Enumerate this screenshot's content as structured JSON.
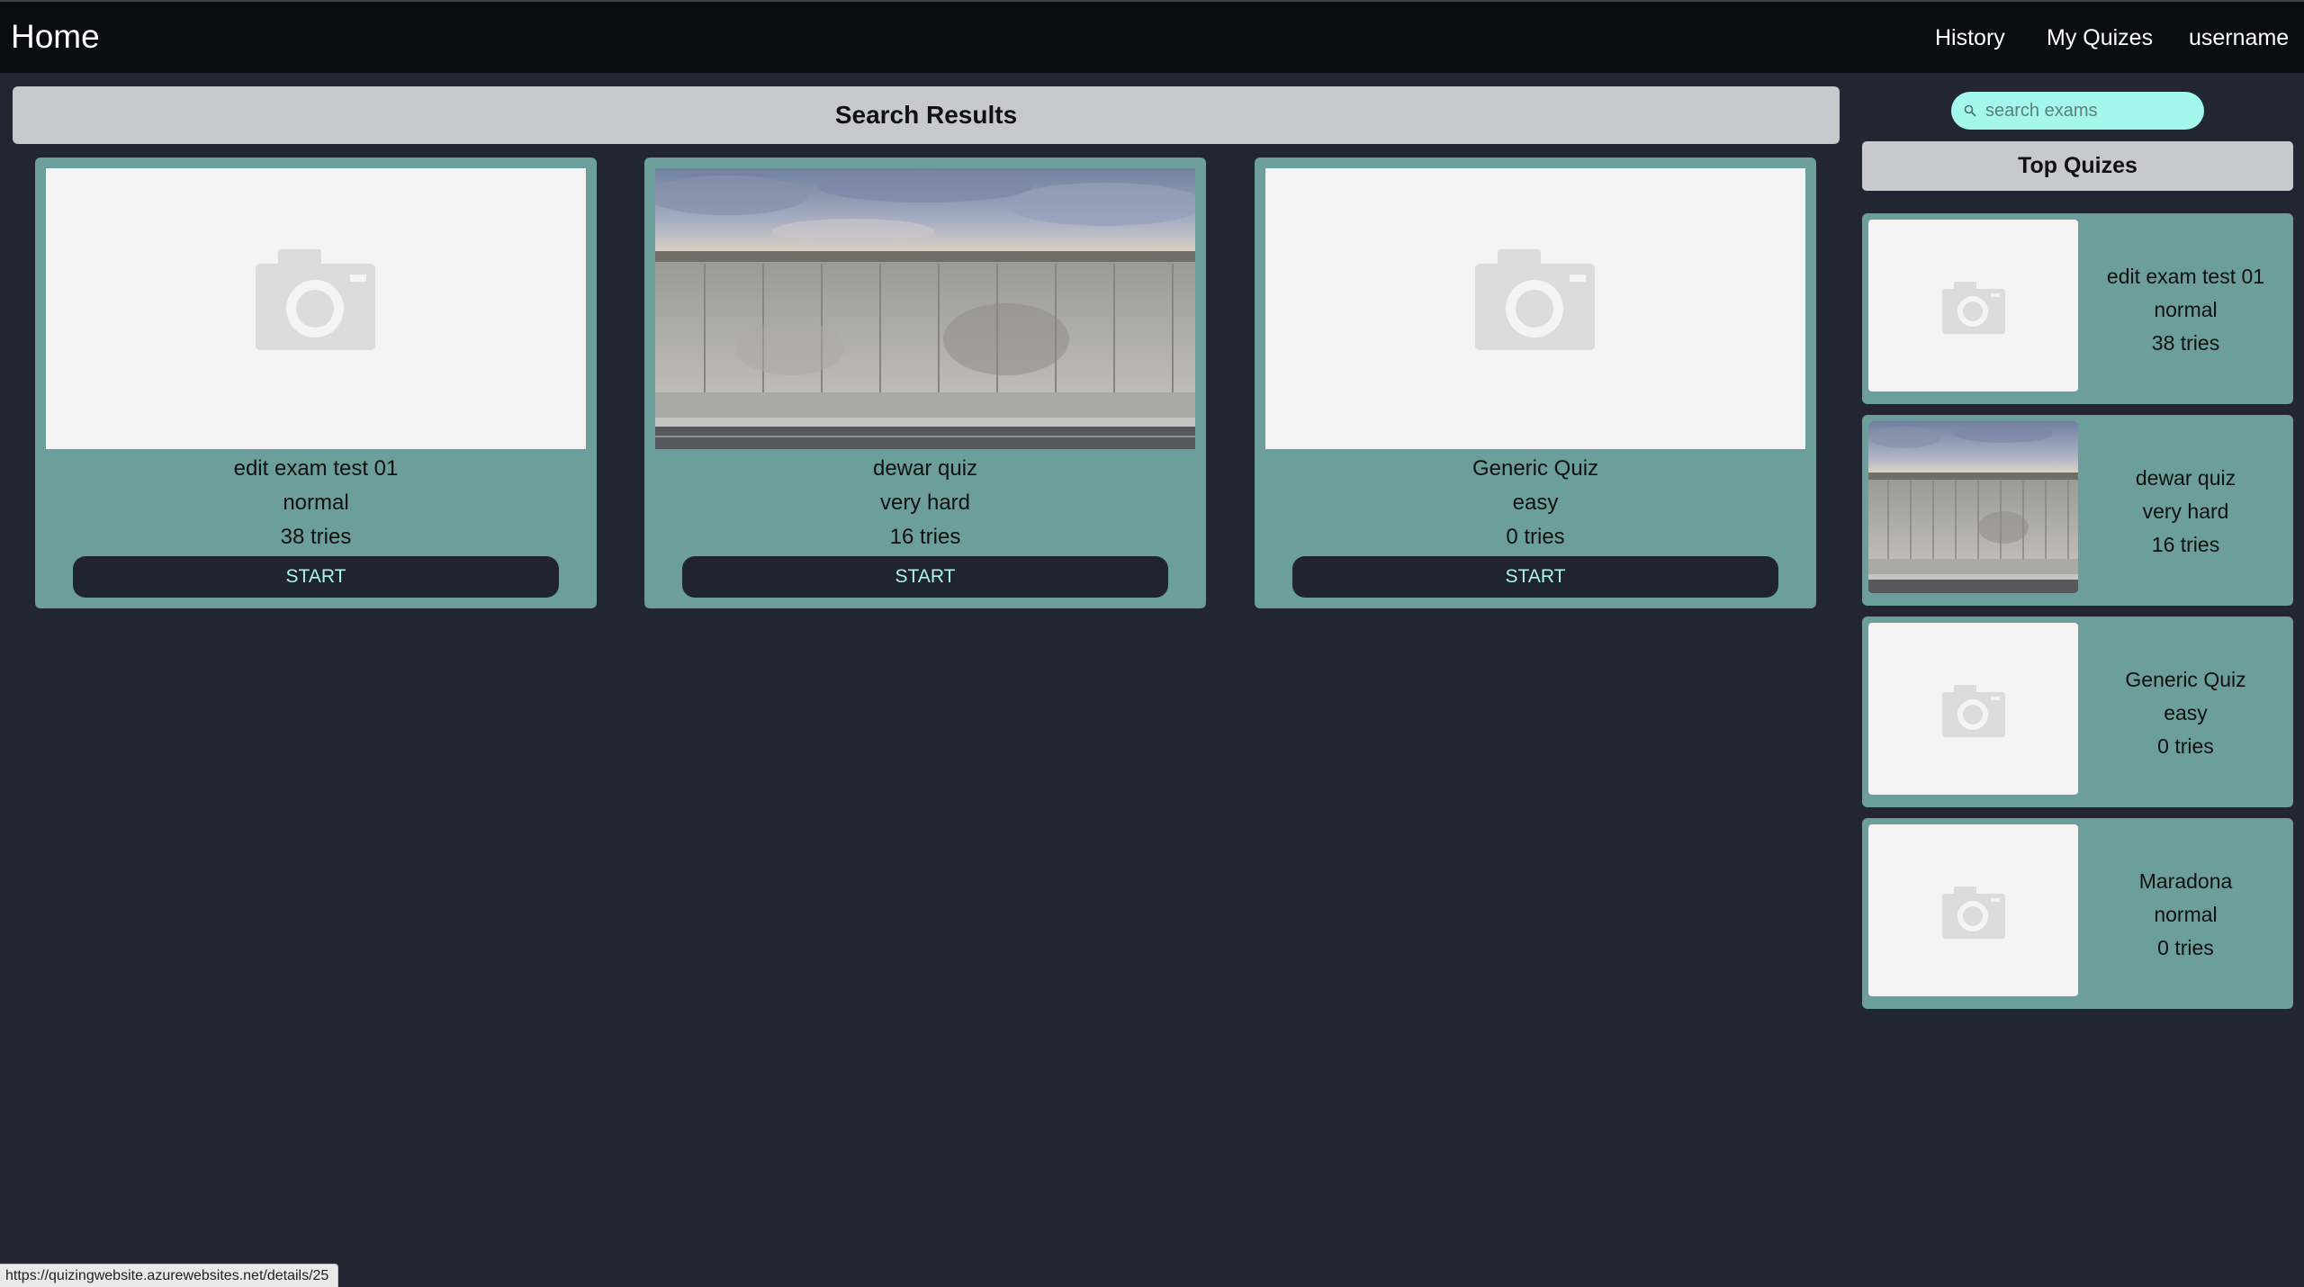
{
  "navbar": {
    "brand": "Home",
    "links": [
      "History",
      "My Quizes",
      "username"
    ]
  },
  "main": {
    "header": "Search Results",
    "cards": [
      {
        "title": "edit exam test 01",
        "difficulty": "normal",
        "tries": "38 tries",
        "button": "START",
        "image": "camera-placeholder"
      },
      {
        "title": "dewar quiz",
        "difficulty": "very hard",
        "tries": "16 tries",
        "button": "START",
        "image": "concrete-wall-photo"
      },
      {
        "title": "Generic Quiz",
        "difficulty": "easy",
        "tries": "0 tries",
        "button": "START",
        "image": "camera-placeholder"
      }
    ]
  },
  "sidebar": {
    "search_placeholder": "search exams",
    "header": "Top Quizes",
    "items": [
      {
        "title": "edit exam test 01",
        "difficulty": "normal",
        "tries": "38 tries",
        "image": "camera-placeholder"
      },
      {
        "title": "dewar quiz",
        "difficulty": "very hard",
        "tries": "16 tries",
        "image": "concrete-wall-photo"
      },
      {
        "title": "Generic Quiz",
        "difficulty": "easy",
        "tries": "0 tries",
        "image": "camera-placeholder"
      },
      {
        "title": "Maradona",
        "difficulty": "normal",
        "tries": "0 tries",
        "image": "camera-placeholder"
      }
    ]
  },
  "status_bar": {
    "url": "https://quizingwebsite.azurewebsites.net/details/25"
  },
  "colors": {
    "page_bg": "#212632",
    "navbar_bg": "#0a0c11",
    "card_bg": "#6c9e9b",
    "button_bg": "#1f2430",
    "button_text": "#a7f7ec",
    "search_bg": "#a4f7ec",
    "header_bg": "#c8c9cc"
  }
}
